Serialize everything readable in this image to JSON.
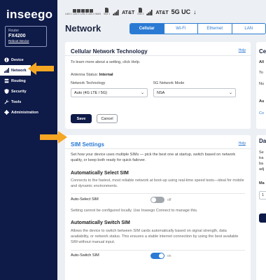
{
  "brand": {
    "logo": "inseego"
  },
  "router": {
    "label": "Router",
    "model": "FX4200",
    "reboot": "Reboot Device"
  },
  "nav": [
    {
      "label": "Device",
      "icon": "info-icon"
    },
    {
      "label": "Network",
      "icon": "signal-bars-icon"
    },
    {
      "label": "Routing",
      "icon": "routing-icon"
    },
    {
      "label": "Security",
      "icon": "shield-icon"
    },
    {
      "label": "Tools",
      "icon": "wrench-icon"
    },
    {
      "label": "Administration",
      "icon": "gear-icon"
    }
  ],
  "status": {
    "lan_labels": [
      "LAN 1",
      "LAN 2",
      "LAN 3",
      "LAN 4",
      "WAN"
    ],
    "sim1": "SIM 1",
    "sim2": "SIM 2",
    "carrier1": "AT&T",
    "carrier2": "AT&T",
    "network_type": "5G UC",
    "download_icon": "↓"
  },
  "page": {
    "title": "Network"
  },
  "tabs": [
    {
      "label": "Cellular",
      "active": true
    },
    {
      "label": "Wi-Fi"
    },
    {
      "label": "Ethernet"
    },
    {
      "label": "LAN"
    }
  ],
  "cellular_tech": {
    "title": "Cellular Network Technology",
    "help": "Help",
    "intro": "To learn more about a setting, click Help.",
    "antenna_label": "Antenna Status:",
    "antenna_value": "Internal",
    "network_tech_label": "Network Technology",
    "network_tech_value": "Auto (4G LTE / 5G)",
    "mode_label": "5G Network Mode",
    "mode_value": "NSA",
    "save": "Save",
    "cancel": "Cancel"
  },
  "sim_settings": {
    "title": "SIM Settings",
    "help": "Help",
    "intro": "Set how your device uses multiple SIMs — pick the best one at startup, switch based on network quality, or keep both ready for quick failover.",
    "auto_select_title": "Automatically Select SIM",
    "auto_select_desc": "Connects to the fastest, most reliable network at boot-up using real-time speed tests—ideal for mobile and dynamic environments.",
    "auto_select_label": "Auto-Select SIM",
    "auto_select_state": "off",
    "auto_select_note": "Setting cannot be configured locally. Use Inseego Connect to manage this.",
    "auto_switch_title": "Automatically Switch SIM",
    "auto_switch_desc": "Allows the device to switch between SIM cards automatically based on signal strength, data availability, or network status. This ensures a stable internet connection by using the best available SIM without manual input.",
    "auto_switch_label": "Auto-Switch SIM",
    "auto_switch_state": "on"
  },
  "right_partial": {
    "card1_title": "Ce",
    "card1_lines": [
      "All",
      "To",
      "Nu",
      "Au",
      "Co"
    ],
    "card2_title": "Da",
    "card2_lines": [
      "Se",
      "tra",
      "ba",
      "adj",
      "Ma",
      "1"
    ]
  },
  "colors": {
    "sidebar": "#0e1a48",
    "accent": "#2a7ad4",
    "arrow": "#f5a623"
  }
}
